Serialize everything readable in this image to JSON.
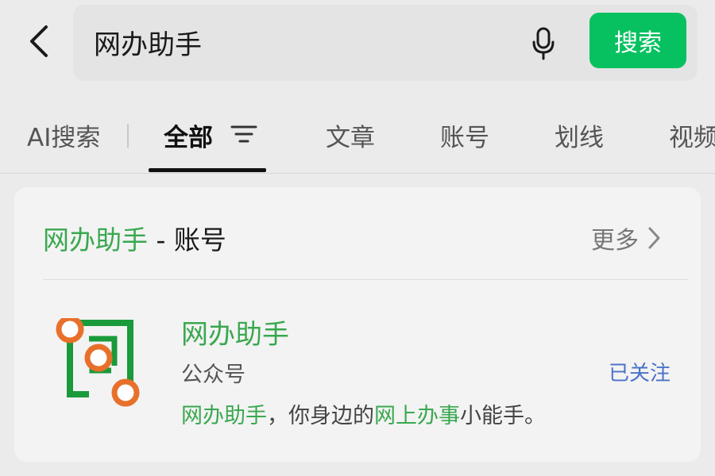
{
  "search": {
    "query": "网办助手",
    "button_label": "搜索"
  },
  "tabs": [
    {
      "label": "AI搜索"
    },
    {
      "label": "全部"
    },
    {
      "label": "文章"
    },
    {
      "label": "账号"
    },
    {
      "label": "划线"
    },
    {
      "label": "视频"
    }
  ],
  "active_tab": "全部",
  "result_section": {
    "header_keyword": "网办助手",
    "header_separator": " - ",
    "header_category": "账号",
    "more_label": "更多"
  },
  "account": {
    "name": "网办助手",
    "type": "公众号",
    "follow_status": "已关注",
    "description_parts": [
      {
        "text": "网办助手",
        "highlight": true
      },
      {
        "text": "，你身边的",
        "highlight": false
      },
      {
        "text": "网上办事",
        "highlight": true
      },
      {
        "text": "小能手。",
        "highlight": false
      }
    ]
  },
  "colors": {
    "accent_green": "#07c160",
    "highlight_green": "#3aa84f",
    "link_blue": "#4a72c9",
    "logo_orange": "#e8702a",
    "logo_green": "#1a9a3a"
  },
  "icons": {
    "back": "chevron-left-icon",
    "mic": "microphone-icon",
    "filter": "filter-icon",
    "more": "chevron-right-icon"
  }
}
